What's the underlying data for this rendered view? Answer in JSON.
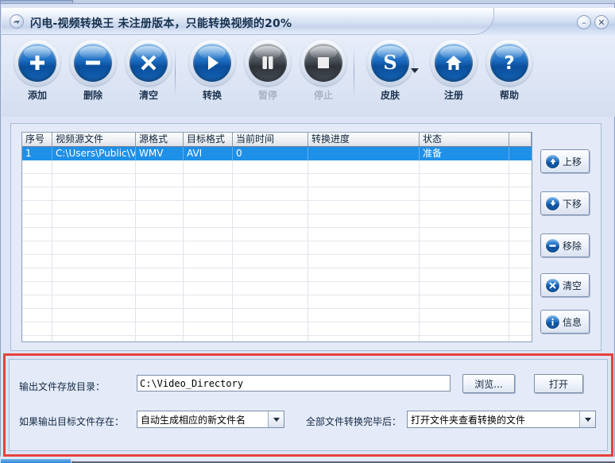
{
  "window": {
    "title": "闪电-视频转换王  未注册版本，只能转换视频的20%",
    "app_icon": "app-logo-icon",
    "minimize_label": "–",
    "close_label": "✕"
  },
  "toolbar": {
    "items": [
      {
        "label": "添加",
        "icon": "plus-icon",
        "disabled": false
      },
      {
        "label": "删除",
        "icon": "minus-icon",
        "disabled": false
      },
      {
        "label": "清空",
        "icon": "cross-icon",
        "disabled": false
      },
      {
        "label": "转换",
        "icon": "play-icon",
        "disabled": false
      },
      {
        "label": "暂停",
        "icon": "pause-icon",
        "disabled": true
      },
      {
        "label": "停止",
        "icon": "stop-icon",
        "disabled": true
      },
      {
        "label": "皮肤",
        "icon": "skin-s-icon",
        "disabled": false
      },
      {
        "label": "注册",
        "icon": "home-icon",
        "disabled": false
      },
      {
        "label": "帮助",
        "icon": "question-icon",
        "disabled": false
      }
    ]
  },
  "list": {
    "columns": [
      "序号",
      "视频源文件",
      "源格式",
      "目标格式",
      "当前时间",
      "转换进度",
      "状态",
      ""
    ],
    "rows": [
      {
        "index": "1",
        "source_file": "C:\\Users\\Public\\Videos\\Sa...",
        "source_format": "WMV",
        "target_format": "AVI",
        "current_time": "0",
        "progress": "",
        "status": "准备",
        "extra": "",
        "selected": true
      }
    ],
    "empty_row_count": 14
  },
  "side_buttons": [
    {
      "label": "上移",
      "icon": "arrow-up-icon"
    },
    {
      "label": "下移",
      "icon": "arrow-down-icon"
    },
    {
      "label": "移除",
      "icon": "minus-icon"
    },
    {
      "label": "清空",
      "icon": "cross-icon"
    },
    {
      "label": "信息",
      "icon": "info-icon"
    }
  ],
  "output": {
    "dir_label": "输出文件存放目录：",
    "dir_value": "C:\\Video_Directory",
    "dir_placeholder": "",
    "browse_label": "浏览...",
    "open_label": "打开",
    "exists_label": "如果输出目标文件存在：",
    "exists_value": "自动生成相应的新文件名",
    "after_label": "全部文件转换完毕后：",
    "after_value": "打开文件夹查看转换的文件"
  },
  "colors": {
    "accent": "#1e90e8",
    "selection": "#1e90e8",
    "red_outline": "#e8403c",
    "panel_bg": "#e4eaf7",
    "window_bg": "#dce4f5"
  }
}
